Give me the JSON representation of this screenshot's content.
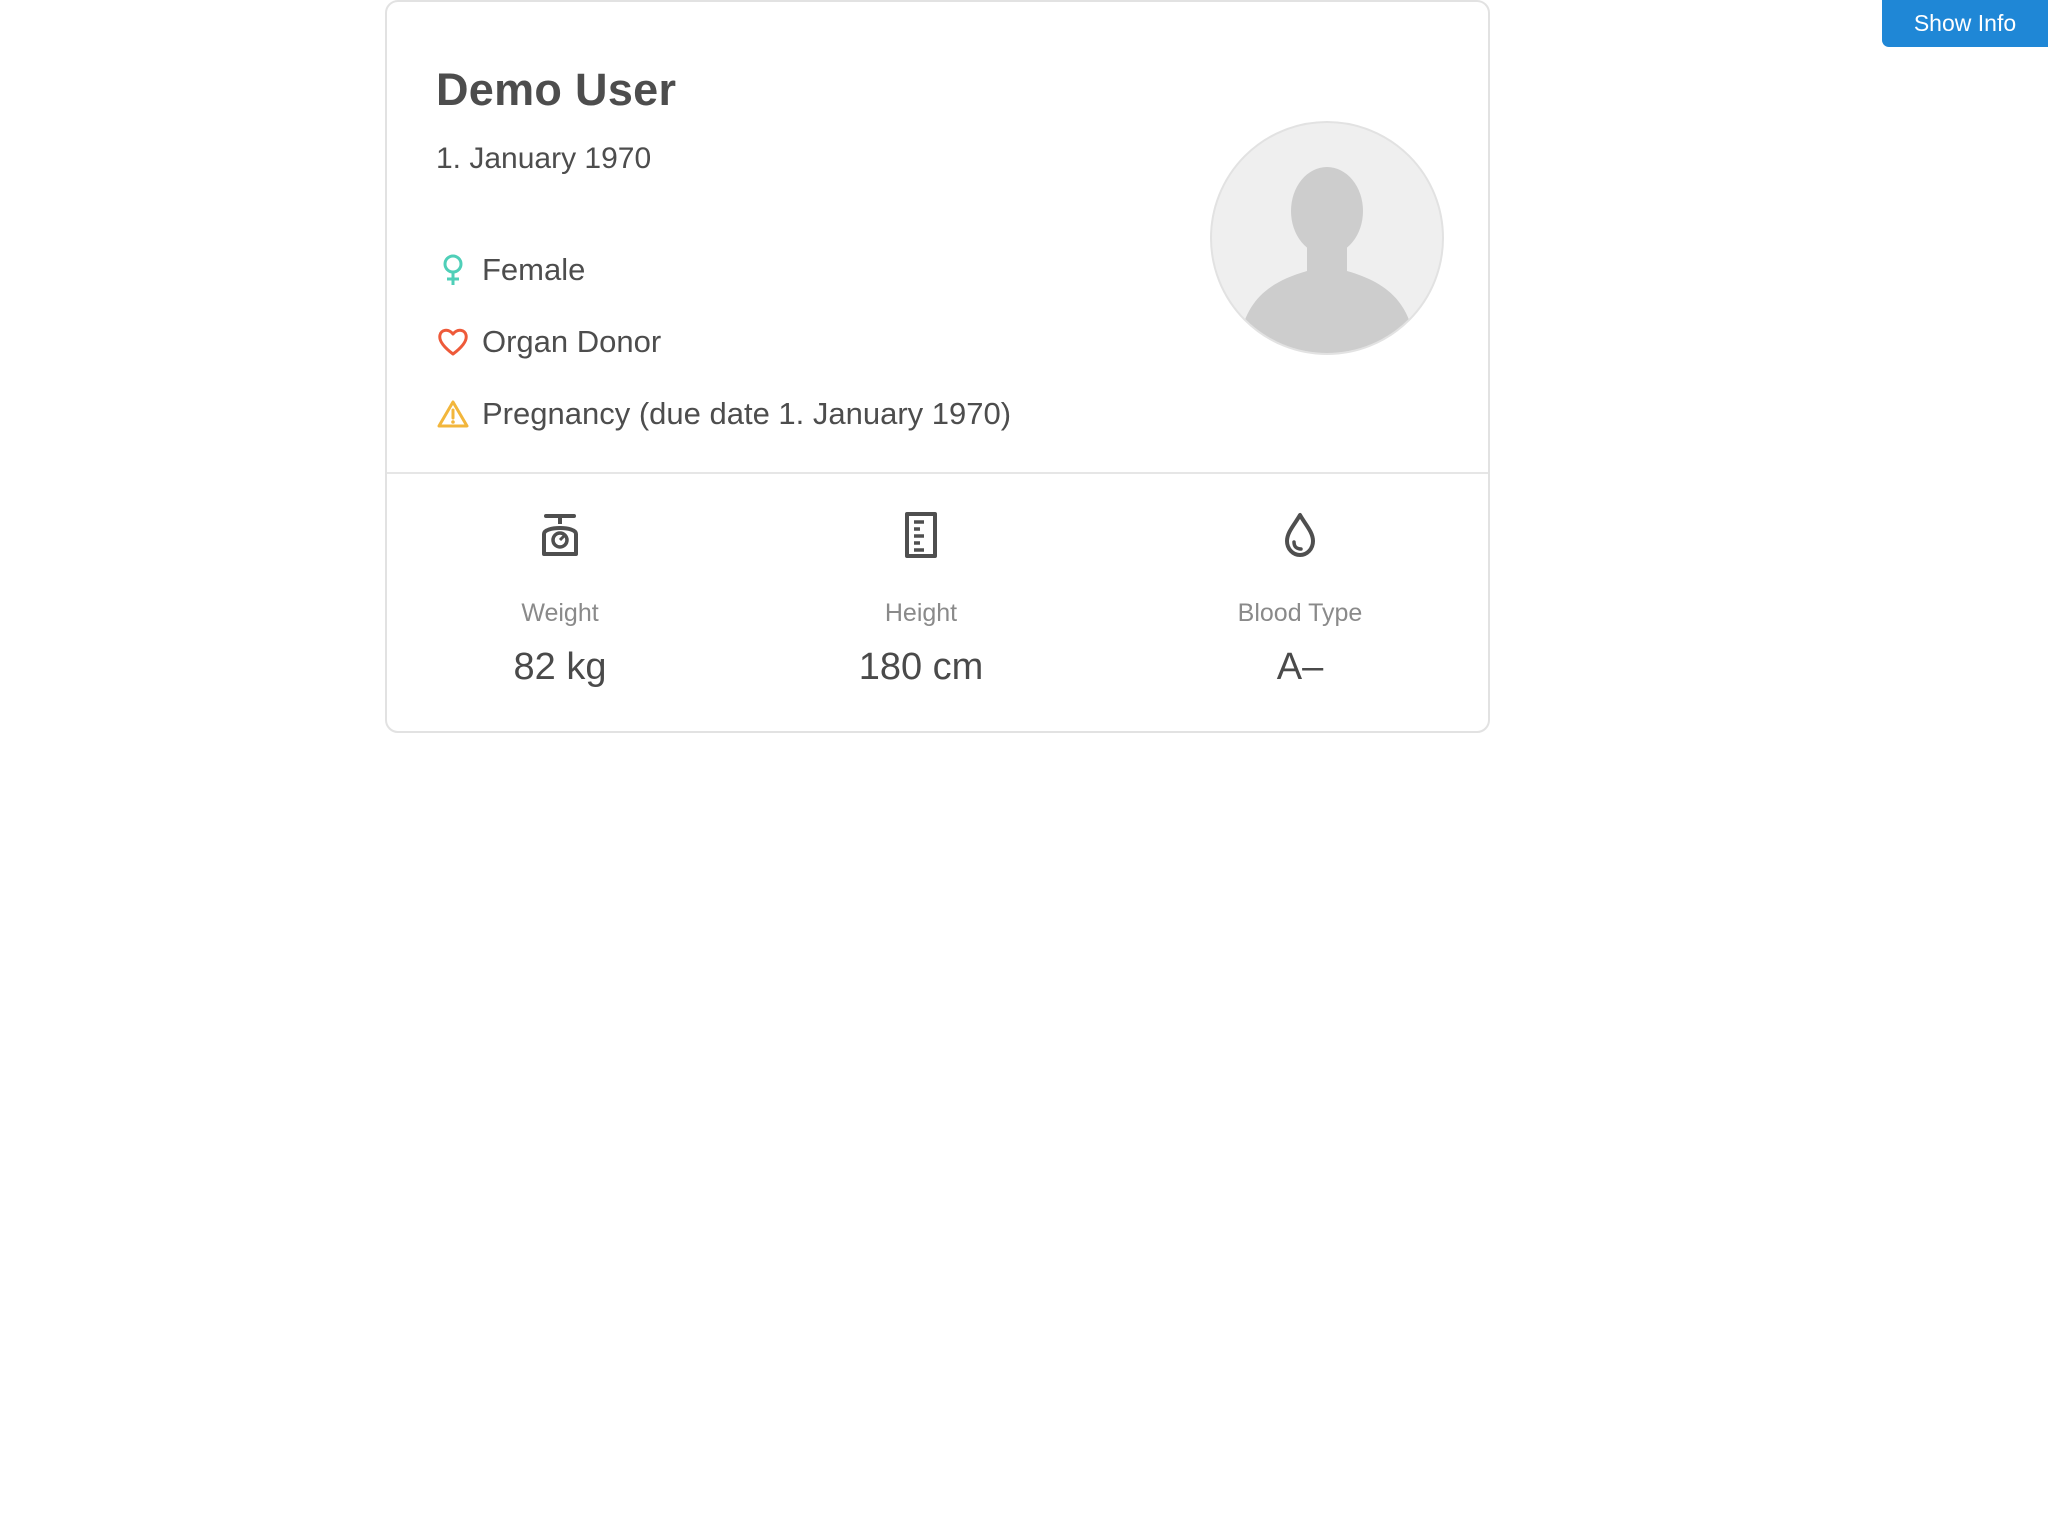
{
  "toolbar": {
    "show_info_label": "Show Info"
  },
  "profile": {
    "name": "Demo User",
    "birth_date": "1. January 1970",
    "details": [
      {
        "icon": "female-icon",
        "label": "Female",
        "color": "#4fcfb8"
      },
      {
        "icon": "heart-icon",
        "label": "Organ Donor",
        "color": "#ee5a3a"
      },
      {
        "icon": "warning-icon",
        "label": "Pregnancy (due date 1. January 1970)",
        "color": "#f2b63c"
      }
    ],
    "avatar_icon": "user-silhouette-icon"
  },
  "stats": {
    "weight": {
      "icon": "scale-icon",
      "label": "Weight",
      "value": "82 kg"
    },
    "height": {
      "icon": "ruler-icon",
      "label": "Height",
      "value": "180 cm"
    },
    "blood_type": {
      "icon": "drop-icon",
      "label": "Blood Type",
      "value": "A–"
    }
  },
  "colors": {
    "accent": "#1f87d6",
    "text": "#4d4d4d",
    "muted": "#8a8a8a",
    "border": "#e2e2e2"
  }
}
